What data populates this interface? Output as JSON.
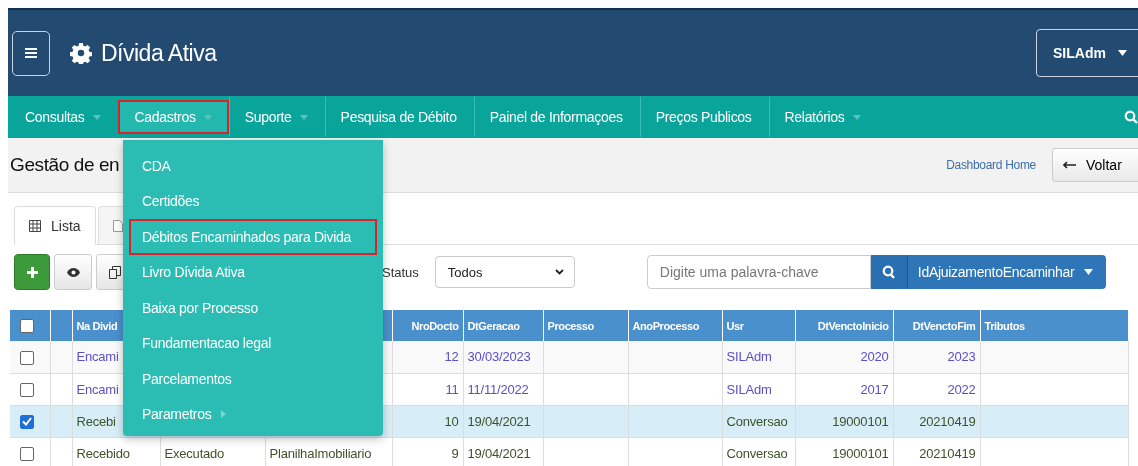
{
  "header": {
    "title": "Dívida Ativa",
    "user": "SILAdm"
  },
  "nav": [
    {
      "label": "Consultas",
      "dropdown": true,
      "selected": false
    },
    {
      "label": "Cadastros",
      "dropdown": true,
      "selected": true
    },
    {
      "label": "Suporte",
      "dropdown": true,
      "selected": false
    },
    {
      "label": "Pesquisa de Débito",
      "dropdown": false,
      "selected": false
    },
    {
      "label": "Painel de Informaçoes",
      "dropdown": false,
      "selected": false
    },
    {
      "label": "Preços Publicos",
      "dropdown": false,
      "selected": false
    },
    {
      "label": "Relatórios",
      "dropdown": true,
      "selected": false
    }
  ],
  "dropdown_menu": {
    "items": [
      {
        "label": "CDA",
        "selected": false,
        "submenu": false
      },
      {
        "label": "Certidões",
        "selected": false,
        "submenu": false
      },
      {
        "label": "Débitos Encaminhados para Divida",
        "selected": true,
        "submenu": false
      },
      {
        "label": "Livro Dívida Ativa",
        "selected": false,
        "submenu": false
      },
      {
        "label": "Baixa por Processo",
        "selected": false,
        "submenu": false
      },
      {
        "label": "Fundamentacao legal",
        "selected": false,
        "submenu": false
      },
      {
        "label": "Parcelamentos",
        "selected": false,
        "submenu": false
      },
      {
        "label": "Parametros",
        "selected": false,
        "submenu": true
      }
    ]
  },
  "page": {
    "title": "Gestão de en",
    "dashboard_link": "Dashboard Home",
    "back_button": "Voltar"
  },
  "tabs": [
    {
      "label": "Lista",
      "selected": true
    },
    {
      "selected": false
    }
  ],
  "toolbar": {
    "status_label": "Status",
    "status_value": "Todos",
    "search_placeholder": "Digite uma palavra-chave",
    "field_button": "IdAjuizamentoEncaminhar"
  },
  "table": {
    "select_all_checked": false,
    "columns": [
      {
        "kind": "text"
      },
      {
        "kind": "text",
        "label": "Na Divid"
      },
      {
        "kind": "text"
      },
      {
        "kind": "text"
      },
      {
        "kind": "number",
        "label": "NroDocto"
      },
      {
        "kind": "text",
        "label": "DtGeracao"
      },
      {
        "kind": "text",
        "label": "Processo"
      },
      {
        "kind": "text",
        "label": "AnoProcesso"
      },
      {
        "kind": "text",
        "label": "Usr"
      },
      {
        "kind": "number",
        "label": "DtVenctoInicio"
      },
      {
        "kind": "number",
        "label": "DtVenctoFim"
      },
      {
        "kind": "text",
        "label": "Tributos"
      }
    ],
    "rows": [
      {
        "checked": false,
        "kind": "link",
        "cells": [
          null,
          "Encami",
          null,
          null,
          "12",
          "30/03/2023",
          null,
          null,
          "SILAdm",
          "2020",
          "2023",
          null
        ]
      },
      {
        "checked": false,
        "kind": "link",
        "cells": [
          null,
          "Encami",
          null,
          null,
          "11",
          "11/11/2022",
          null,
          null,
          "SILAdm",
          "2017",
          "2022",
          null
        ]
      },
      {
        "checked": true,
        "kind": "plain",
        "cells": [
          null,
          "Recebi",
          null,
          null,
          "10",
          "19/04/2021",
          null,
          null,
          "Conversao",
          "19000101",
          "20210419",
          null
        ]
      },
      {
        "checked": false,
        "kind": "plain",
        "cells": [
          null,
          "Recebido",
          "Executado",
          "PlanilhaImobiliario",
          "9",
          "19/04/2021",
          null,
          null,
          "Conversao",
          "19000101",
          "20210419",
          null
        ]
      }
    ]
  }
}
